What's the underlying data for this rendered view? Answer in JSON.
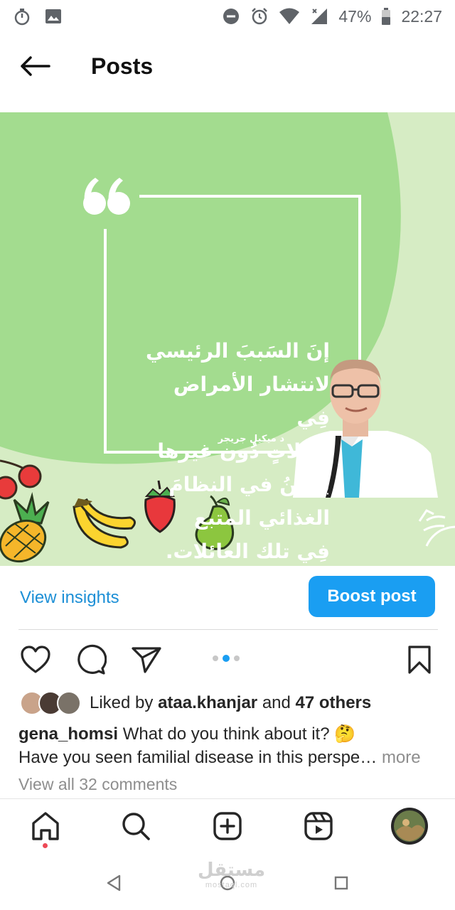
{
  "status_bar": {
    "battery": "47%",
    "time": "22:27"
  },
  "header": {
    "title": "Posts"
  },
  "post": {
    "quote_lines": [
      "إنَ السَببَ الرئيسي",
      "لانتشار الأمراض فِي",
      "عائلاتٍ دُون غيرها",
      "يكمنُ في النظامَ",
      "الغذائي المتبع",
      "فِي تلك العائلات."
    ],
    "quote_author": "د ميكيل جريجر",
    "colors": {
      "background": "#d6ecc4",
      "accent_green": "#a3dc8f",
      "brand_blue": "#1a9ef2"
    }
  },
  "insights": {
    "view_insights": "View insights",
    "boost_post": "Boost post"
  },
  "carousel": {
    "count": 3,
    "active_index": 1
  },
  "likes": {
    "prefix": "Liked by",
    "user": "ataa.khanjar",
    "conjunction": "and",
    "others": "47 others"
  },
  "caption": {
    "username": "gena_homsi",
    "text": "What do you think about it? 🤔",
    "line2": "Have you seen familial disease in this perspe…",
    "more": "more"
  },
  "comments": {
    "link": "View all 32 comments"
  },
  "watermark": {
    "text": "مستقل",
    "sub": "mostaql.com"
  }
}
